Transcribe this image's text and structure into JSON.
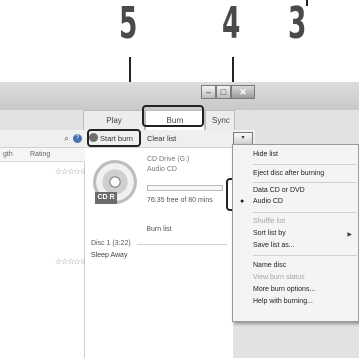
{
  "callouts": [
    "5",
    "4",
    "3"
  ],
  "window": {
    "title_buttons": {
      "min": "–",
      "max": "□",
      "close": "✕"
    },
    "tabs": [
      "Play",
      "Burn",
      "Sync"
    ],
    "left_pane": {
      "columns": [
        "gth",
        "Rating"
      ],
      "stars": [
        "☆☆☆☆☆",
        "☆☆☆☆☆"
      ]
    },
    "toolbar": {
      "start_burn": "Start burn",
      "clear_list": "Clear list"
    },
    "drive": {
      "name": "CD Drive (G:)",
      "type": "Audio CD",
      "free": "76:35 free of 80 mins",
      "badge": "CD R"
    },
    "burn_list": {
      "title": "Burn list",
      "disc": "Disc 1 (3:22)",
      "track": "Sleep Away"
    }
  },
  "menu": {
    "items": [
      {
        "label": "Hide list",
        "disabled": false
      },
      {
        "label": "Eject disc after burning",
        "disabled": false
      },
      {
        "label": "Data CD or DVD",
        "disabled": false
      },
      {
        "label": "Audio CD",
        "disabled": false,
        "selected": true
      },
      {
        "label": "Shuffle list",
        "disabled": true
      },
      {
        "label": "Sort list by",
        "disabled": false,
        "submenu": true
      },
      {
        "label": "Save list as...",
        "disabled": false
      },
      {
        "label": "Name disc",
        "disabled": false
      },
      {
        "label": "View burn status",
        "disabled": true
      },
      {
        "label": "More burn options...",
        "disabled": false
      },
      {
        "label": "Help with burning...",
        "disabled": false
      }
    ]
  },
  "icons": {
    "search": "search-icon",
    "help": "help-icon",
    "options": "options-icon",
    "cd": "cd-disc-icon"
  }
}
